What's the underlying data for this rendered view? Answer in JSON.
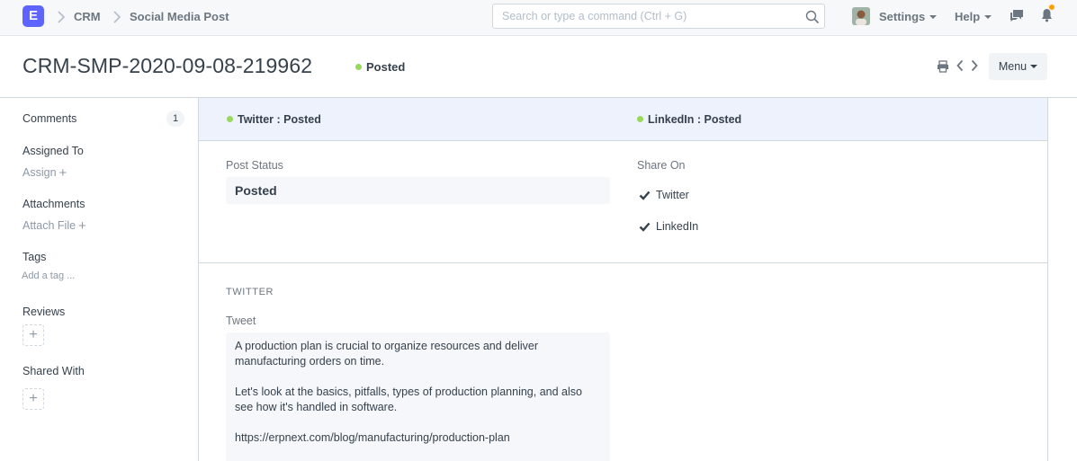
{
  "navbar": {
    "logo_letter": "E",
    "breadcrumbs": [
      "CRM",
      "Social Media Post"
    ],
    "search_placeholder": "Search or type a command (Ctrl + G)",
    "settings_label": "Settings",
    "help_label": "Help"
  },
  "page": {
    "title": "CRM-SMP-2020-09-08-219962",
    "status": "Posted",
    "menu_label": "Menu"
  },
  "sidebar": {
    "comments_label": "Comments",
    "comments_count": "1",
    "assigned_to_label": "Assigned To",
    "assign_link": "Assign",
    "attachments_label": "Attachments",
    "attach_link": "Attach File",
    "tags_label": "Tags",
    "add_tag_link": "Add a tag ...",
    "reviews_label": "Reviews",
    "shared_with_label": "Shared With"
  },
  "form": {
    "twitter_status": "Twitter : Posted",
    "linkedin_status": "LinkedIn : Posted",
    "post_status_label": "Post Status",
    "post_status_value": "Posted",
    "share_on_label": "Share On",
    "share_options": [
      "Twitter",
      "LinkedIn"
    ],
    "twitter_section": "TWITTER",
    "tweet_label": "Tweet",
    "tweet_paragraphs": [
      "A production plan is crucial to organize resources and deliver manufacturing orders on time.",
      "Let's look at the basics, pitfalls, types of production planning, and also see how it's handled in software.",
      "https://erpnext.com/blog/manufacturing/production-plan"
    ]
  },
  "colors": {
    "accent": "#5e64ff",
    "status_green": "#98d85b",
    "notification_dot": "#ffa00a",
    "status_strip": "#eef2fc"
  }
}
